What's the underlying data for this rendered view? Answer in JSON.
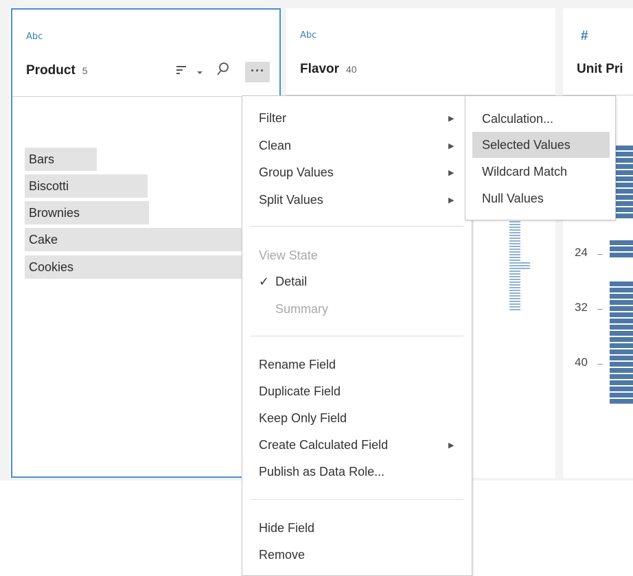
{
  "columns": {
    "product": {
      "type_icon": "Abc",
      "name": "Product",
      "count": "5"
    },
    "flavor": {
      "type_icon": "Abc",
      "name": "Flavor",
      "count": "40"
    },
    "unit_price": {
      "type_icon": "#",
      "name": "Unit Pri"
    }
  },
  "product_values": [
    "Bars",
    "Biscotti",
    "Brownies",
    "Cake",
    "Cookies"
  ],
  "unit_axis": [
    "24",
    "32",
    "40"
  ],
  "toolbar_icons": [
    "sort-icon",
    "dropdown-caret-icon",
    "search-icon",
    "more-options-icon"
  ],
  "menu": {
    "group1": [
      "Filter",
      "Clean",
      "Group Values",
      "Split Values"
    ],
    "view_state_label": "View State",
    "checkmark": "✓",
    "view_detail": "Detail",
    "view_summary": "Summary",
    "group3": [
      "Rename Field",
      "Duplicate Field",
      "Keep Only Field",
      "Create Calculated Field",
      "Publish as Data Role..."
    ],
    "group4": [
      "Hide Field",
      "Remove"
    ]
  },
  "submenu": {
    "items": [
      "Calculation...",
      "Selected Values",
      "Wildcard Match",
      "Null Values"
    ],
    "highlighted": "Selected Values"
  },
  "colors": {
    "accent": "#4a8fd1",
    "bar": "#4e79a7",
    "highlight": "#d9d9d9"
  }
}
